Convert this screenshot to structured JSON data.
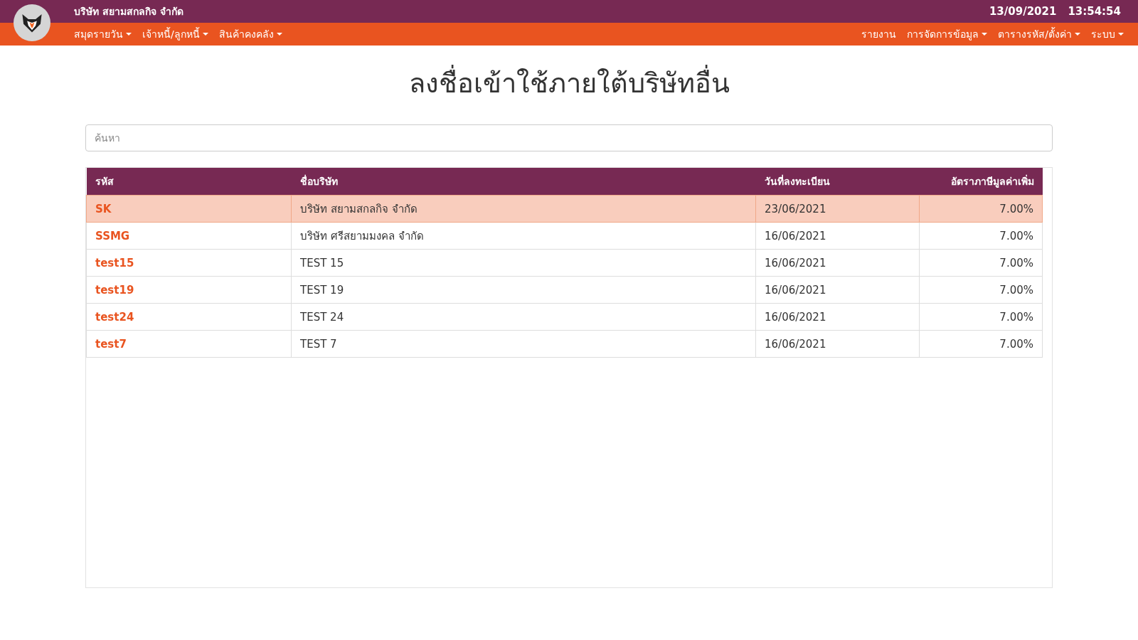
{
  "header": {
    "company": "บริษัท สยามสกลกิจ จำกัด",
    "date": "13/09/2021",
    "time": "13:54:54"
  },
  "menu_left": [
    {
      "label": "สมุดรายวัน",
      "dropdown": true
    },
    {
      "label": "เจ้าหนี้/ลูกหนี้",
      "dropdown": true
    },
    {
      "label": "สินค้าคงคลัง",
      "dropdown": true
    }
  ],
  "menu_right": [
    {
      "label": "รายงาน",
      "dropdown": false
    },
    {
      "label": "การจัดการข้อมูล",
      "dropdown": true
    },
    {
      "label": "ตารางรหัส/ตั้งค่า",
      "dropdown": true
    },
    {
      "label": "ระบบ",
      "dropdown": true
    }
  ],
  "page_title": "ลงชื่อเข้าใช้ภายใต้บริษัทอื่น",
  "search": {
    "placeholder": "ค้นหา"
  },
  "table": {
    "columns": [
      "รหัส",
      "ชื่อบริษัท",
      "วันที่ลงทะเบียน",
      "อัตราภาษีมูลค่าเพิ่ม"
    ],
    "rows": [
      {
        "code": "SK",
        "name": "บริษัท สยามสกลกิจ จำกัด",
        "registered": "23/06/2021",
        "vat": "7.00%",
        "selected": true
      },
      {
        "code": "SSMG",
        "name": "บริษัท ศรีสยามมงคล จำกัด",
        "registered": "16/06/2021",
        "vat": "7.00%",
        "selected": false
      },
      {
        "code": "test15",
        "name": "TEST 15",
        "registered": "16/06/2021",
        "vat": "7.00%",
        "selected": false
      },
      {
        "code": "test19",
        "name": "TEST 19",
        "registered": "16/06/2021",
        "vat": "7.00%",
        "selected": false
      },
      {
        "code": "test24",
        "name": "TEST 24",
        "registered": "16/06/2021",
        "vat": "7.00%",
        "selected": false
      },
      {
        "code": "test7",
        "name": "TEST 7",
        "registered": "16/06/2021",
        "vat": "7.00%",
        "selected": false
      }
    ]
  }
}
